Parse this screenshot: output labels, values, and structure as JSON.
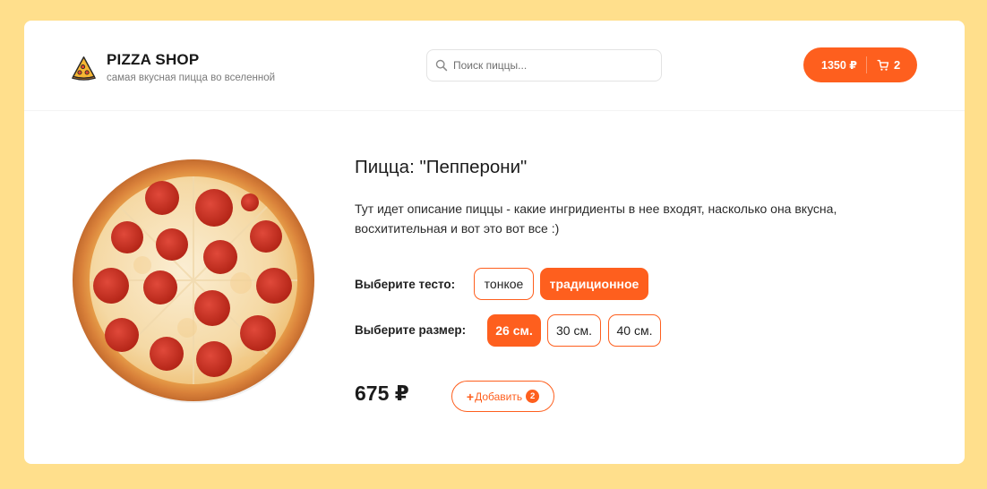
{
  "header": {
    "logo_title": "PIZZA SHOP",
    "logo_subtitle": "самая вкусная пицца во вселенной",
    "search_placeholder": "Поиск пиццы...",
    "cart_total": "1350 ₽",
    "cart_count": "2"
  },
  "product": {
    "title": "Пицца: \"Пепперони\"",
    "description": "Тут идет описание пиццы - какие ингридиенты в нее входят, насколько она вкусна, восхитительная и вот это вот все :)",
    "dough_label": "Выберите тесто:",
    "dough_options": [
      {
        "label": "тонкое",
        "selected": false
      },
      {
        "label": "традиционное",
        "selected": true
      }
    ],
    "size_label": "Выберите размер:",
    "size_options": [
      {
        "label": "26 см.",
        "selected": true
      },
      {
        "label": "30 см.",
        "selected": false
      },
      {
        "label": "40 см.",
        "selected": false
      }
    ],
    "price": "675 ₽",
    "add_label": "Добавить",
    "add_count": "2"
  },
  "colors": {
    "accent": "#fe5f1e",
    "background": "#ffdf8c",
    "card": "#ffffff"
  },
  "icons": {
    "logo": "pizza-slice-icon",
    "search": "search-icon",
    "cart": "cart-icon",
    "add": "plus-icon"
  }
}
